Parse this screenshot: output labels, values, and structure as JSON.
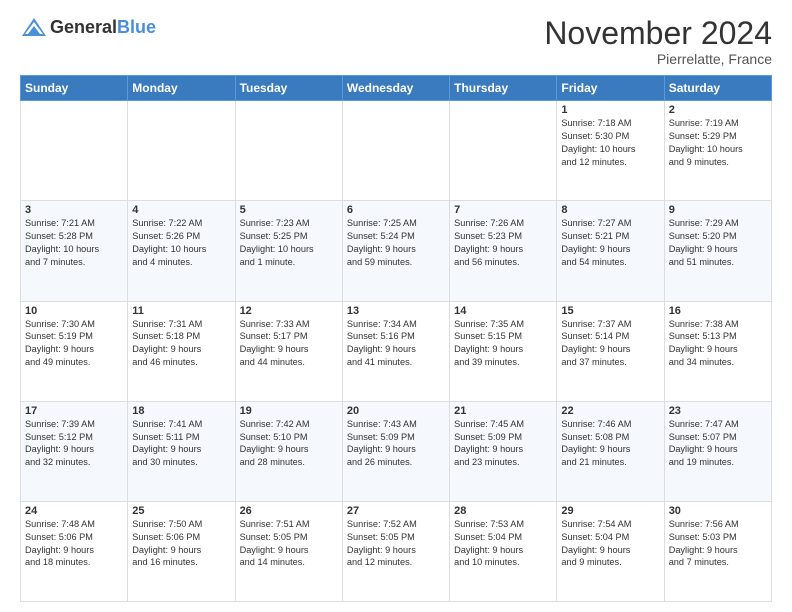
{
  "header": {
    "logo_general": "General",
    "logo_blue": "Blue",
    "month": "November 2024",
    "location": "Pierrelatte, France"
  },
  "weekdays": [
    "Sunday",
    "Monday",
    "Tuesday",
    "Wednesday",
    "Thursday",
    "Friday",
    "Saturday"
  ],
  "weeks": [
    [
      {
        "day": "",
        "info": ""
      },
      {
        "day": "",
        "info": ""
      },
      {
        "day": "",
        "info": ""
      },
      {
        "day": "",
        "info": ""
      },
      {
        "day": "",
        "info": ""
      },
      {
        "day": "1",
        "info": "Sunrise: 7:18 AM\nSunset: 5:30 PM\nDaylight: 10 hours\nand 12 minutes."
      },
      {
        "day": "2",
        "info": "Sunrise: 7:19 AM\nSunset: 5:29 PM\nDaylight: 10 hours\nand 9 minutes."
      }
    ],
    [
      {
        "day": "3",
        "info": "Sunrise: 7:21 AM\nSunset: 5:28 PM\nDaylight: 10 hours\nand 7 minutes."
      },
      {
        "day": "4",
        "info": "Sunrise: 7:22 AM\nSunset: 5:26 PM\nDaylight: 10 hours\nand 4 minutes."
      },
      {
        "day": "5",
        "info": "Sunrise: 7:23 AM\nSunset: 5:25 PM\nDaylight: 10 hours\nand 1 minute."
      },
      {
        "day": "6",
        "info": "Sunrise: 7:25 AM\nSunset: 5:24 PM\nDaylight: 9 hours\nand 59 minutes."
      },
      {
        "day": "7",
        "info": "Sunrise: 7:26 AM\nSunset: 5:23 PM\nDaylight: 9 hours\nand 56 minutes."
      },
      {
        "day": "8",
        "info": "Sunrise: 7:27 AM\nSunset: 5:21 PM\nDaylight: 9 hours\nand 54 minutes."
      },
      {
        "day": "9",
        "info": "Sunrise: 7:29 AM\nSunset: 5:20 PM\nDaylight: 9 hours\nand 51 minutes."
      }
    ],
    [
      {
        "day": "10",
        "info": "Sunrise: 7:30 AM\nSunset: 5:19 PM\nDaylight: 9 hours\nand 49 minutes."
      },
      {
        "day": "11",
        "info": "Sunrise: 7:31 AM\nSunset: 5:18 PM\nDaylight: 9 hours\nand 46 minutes."
      },
      {
        "day": "12",
        "info": "Sunrise: 7:33 AM\nSunset: 5:17 PM\nDaylight: 9 hours\nand 44 minutes."
      },
      {
        "day": "13",
        "info": "Sunrise: 7:34 AM\nSunset: 5:16 PM\nDaylight: 9 hours\nand 41 minutes."
      },
      {
        "day": "14",
        "info": "Sunrise: 7:35 AM\nSunset: 5:15 PM\nDaylight: 9 hours\nand 39 minutes."
      },
      {
        "day": "15",
        "info": "Sunrise: 7:37 AM\nSunset: 5:14 PM\nDaylight: 9 hours\nand 37 minutes."
      },
      {
        "day": "16",
        "info": "Sunrise: 7:38 AM\nSunset: 5:13 PM\nDaylight: 9 hours\nand 34 minutes."
      }
    ],
    [
      {
        "day": "17",
        "info": "Sunrise: 7:39 AM\nSunset: 5:12 PM\nDaylight: 9 hours\nand 32 minutes."
      },
      {
        "day": "18",
        "info": "Sunrise: 7:41 AM\nSunset: 5:11 PM\nDaylight: 9 hours\nand 30 minutes."
      },
      {
        "day": "19",
        "info": "Sunrise: 7:42 AM\nSunset: 5:10 PM\nDaylight: 9 hours\nand 28 minutes."
      },
      {
        "day": "20",
        "info": "Sunrise: 7:43 AM\nSunset: 5:09 PM\nDaylight: 9 hours\nand 26 minutes."
      },
      {
        "day": "21",
        "info": "Sunrise: 7:45 AM\nSunset: 5:09 PM\nDaylight: 9 hours\nand 23 minutes."
      },
      {
        "day": "22",
        "info": "Sunrise: 7:46 AM\nSunset: 5:08 PM\nDaylight: 9 hours\nand 21 minutes."
      },
      {
        "day": "23",
        "info": "Sunrise: 7:47 AM\nSunset: 5:07 PM\nDaylight: 9 hours\nand 19 minutes."
      }
    ],
    [
      {
        "day": "24",
        "info": "Sunrise: 7:48 AM\nSunset: 5:06 PM\nDaylight: 9 hours\nand 18 minutes."
      },
      {
        "day": "25",
        "info": "Sunrise: 7:50 AM\nSunset: 5:06 PM\nDaylight: 9 hours\nand 16 minutes."
      },
      {
        "day": "26",
        "info": "Sunrise: 7:51 AM\nSunset: 5:05 PM\nDaylight: 9 hours\nand 14 minutes."
      },
      {
        "day": "27",
        "info": "Sunrise: 7:52 AM\nSunset: 5:05 PM\nDaylight: 9 hours\nand 12 minutes."
      },
      {
        "day": "28",
        "info": "Sunrise: 7:53 AM\nSunset: 5:04 PM\nDaylight: 9 hours\nand 10 minutes."
      },
      {
        "day": "29",
        "info": "Sunrise: 7:54 AM\nSunset: 5:04 PM\nDaylight: 9 hours\nand 9 minutes."
      },
      {
        "day": "30",
        "info": "Sunrise: 7:56 AM\nSunset: 5:03 PM\nDaylight: 9 hours\nand 7 minutes."
      }
    ]
  ]
}
